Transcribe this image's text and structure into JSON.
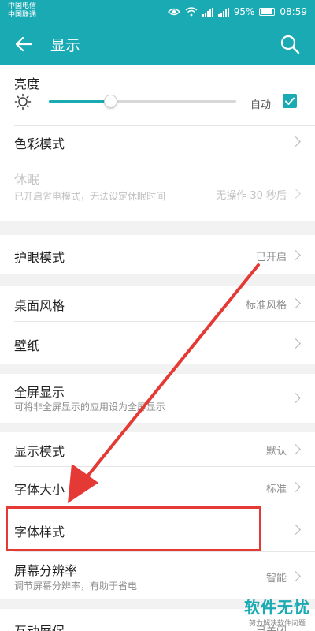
{
  "status_bar": {
    "carrier_1": "中国电信",
    "carrier_2": "中国联通",
    "battery": "95%",
    "time": "08:59"
  },
  "header": {
    "title": "显示"
  },
  "brightness": {
    "label": "亮度",
    "auto_label": "自动",
    "auto_checked": true,
    "level": 0.33
  },
  "items": [
    {
      "label": "色彩模式",
      "value": ""
    },
    {
      "label": "休眠",
      "sub": "已开启省电模式，无法设定休眠时间",
      "value": "无操作 30 秒后",
      "disabled": true
    },
    {
      "label": "护眼模式",
      "value": "已开启"
    },
    {
      "label": "桌面风格",
      "value": "标准风格"
    },
    {
      "label": "壁纸",
      "value": ""
    },
    {
      "label": "全屏显示",
      "sub": "可将非全屏显示的应用设为全屏显示",
      "value": ""
    },
    {
      "label": "显示模式",
      "value": "默认"
    },
    {
      "label": "字体大小",
      "value": "标准"
    },
    {
      "label": "字体样式",
      "value": ""
    },
    {
      "label": "屏幕分辨率",
      "sub": "调节屏幕分辨率，有助于省电",
      "value": "智能"
    },
    {
      "label": "互动屏保",
      "value": "已关闭"
    }
  ],
  "watermark": {
    "main": "软件无忧",
    "sub": "努力解决软件问题"
  },
  "colors": {
    "accent": "#1aaab4",
    "annotation": "#e53935"
  }
}
